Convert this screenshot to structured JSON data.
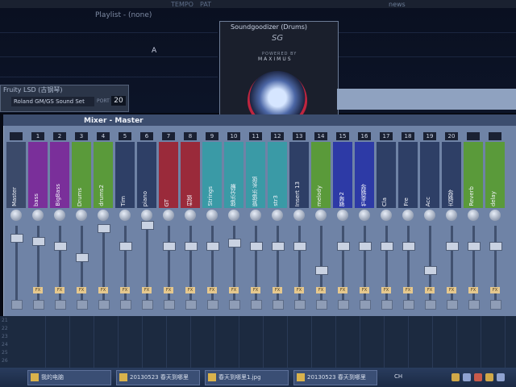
{
  "playlist": {
    "title": "Playlist - (none)",
    "marker": "A",
    "news": "news",
    "tempo": "TEMPO",
    "pat": "PAT"
  },
  "fruity_lsd": {
    "title": "Fruity LSD (古钢琴)",
    "sound_set": "Roland GM/GS Sound Set",
    "port_label": "PORT",
    "port_value": "20"
  },
  "soundgoodizer": {
    "title": "Soundgoodizer (Drums)",
    "logo": "SG",
    "powered": "POWERED BY",
    "brand": "MAXIMUS"
  },
  "mixer": {
    "title": "Mixer - Master",
    "fx_label": "FX",
    "strips": [
      {
        "num": "",
        "name": "Master",
        "color": "#3b4a6a"
      },
      {
        "num": "1",
        "name": "bass",
        "color": "#7a2f9a"
      },
      {
        "num": "2",
        "name": "BigBass",
        "color": "#7a2f9a"
      },
      {
        "num": "3",
        "name": "Drums",
        "color": "#5a9a3a"
      },
      {
        "num": "4",
        "name": "drums2",
        "color": "#5a9a3a"
      },
      {
        "num": "5",
        "name": "Tim",
        "color": "#2e3f66"
      },
      {
        "num": "6",
        "name": "piano",
        "color": "#2e3f66"
      },
      {
        "num": "7",
        "name": "GT",
        "color": "#9a2a3a"
      },
      {
        "num": "8",
        "name": "扫弦",
        "color": "#9a2a3a"
      },
      {
        "num": "9",
        "name": "Strings",
        "color": "#3a9aa6"
      },
      {
        "num": "10",
        "name": "弦乐分解",
        "color": "#3a9aa6"
      },
      {
        "num": "11",
        "name": "管弦乐 长弦",
        "color": "#3a9aa6"
      },
      {
        "num": "12",
        "name": "str3",
        "color": "#3a9aa6"
      },
      {
        "num": "13",
        "name": "Insert 13",
        "color": "#2e3f66"
      },
      {
        "num": "14",
        "name": "melody",
        "color": "#5a9a3a"
      },
      {
        "num": "15",
        "name": "钢琴2",
        "color": "#2d3aa6"
      },
      {
        "num": "16",
        "name": "节奏钢琴",
        "color": "#2d3aa6"
      },
      {
        "num": "17",
        "name": "Cla",
        "color": "#2e3f66"
      },
      {
        "num": "18",
        "name": "Fre",
        "color": "#2e3f66"
      },
      {
        "num": "19",
        "name": "Acc",
        "color": "#2e3f66"
      },
      {
        "num": "20",
        "name": "古钢琴",
        "color": "#2e3f66"
      },
      {
        "num": "",
        "name": "Reverb",
        "color": "#5a9a3a"
      },
      {
        "num": "",
        "name": "delay",
        "color": "#5a9a3a"
      }
    ]
  },
  "rows": [
    "21",
    "22",
    "23",
    "24",
    "25",
    "26"
  ],
  "taskbar": {
    "tasks": [
      {
        "label": "我的电脑"
      },
      {
        "label": "20130523 春天到哪里"
      },
      {
        "label": "春天到哪里1.jpg"
      },
      {
        "label": "20130523 春天到哪里"
      }
    ],
    "lang": "CH"
  }
}
